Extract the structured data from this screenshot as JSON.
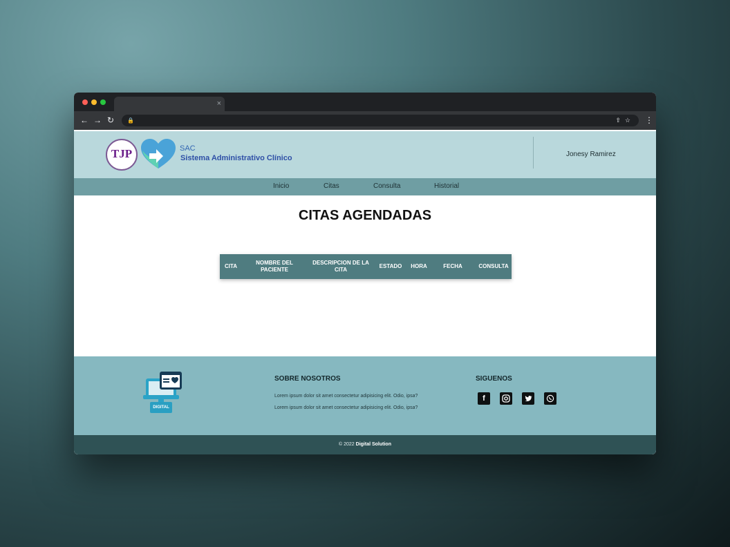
{
  "browser": {
    "traffic_lights": [
      "#ff5f57",
      "#febc2e",
      "#28c840"
    ],
    "tab": {
      "close_glyph": "×"
    },
    "toolbar": {
      "back_icon": "←",
      "forward_icon": "→",
      "reload_icon": "↻",
      "lock_icon": "lock-icon",
      "share_icon": "share-icon",
      "star_icon": "star-icon",
      "menu_icon": "kebab-menu-icon"
    }
  },
  "header": {
    "seal_text": "TJP",
    "brand_short": "SAC",
    "brand_name": "Sistema Administrativo Clínico",
    "user_name": "Jonesy Ramirez"
  },
  "nav": {
    "items": [
      {
        "label": "Inicio"
      },
      {
        "label": "Citas"
      },
      {
        "label": "Consulta"
      },
      {
        "label": "Historial"
      }
    ]
  },
  "main": {
    "title": "CITAS AGENDADAS",
    "table": {
      "columns": [
        "CITA",
        "NOMBRE DEL PACIENTE",
        "DESCRIPCION DE LA CITA",
        "ESTADO",
        "HORA",
        "FECHA",
        "CONSULTA"
      ],
      "rows": []
    }
  },
  "footer": {
    "logo_text": "DIGITAL",
    "about_heading": "SOBRE NOSOTROS",
    "about_lines": [
      "Lorem ipsum dolor sit amet consectetur adipisicing elit. Odio, ipsa?",
      "Lorem ipsum dolor sit amet consectetur adipisicing elit. Odio, ipsa?"
    ],
    "follow_heading": "SIGUENOS",
    "social_icons": [
      "facebook-icon",
      "instagram-icon",
      "twitter-icon",
      "whatsapp-icon"
    ],
    "copyright_prefix": "© 2022",
    "copyright_brand": "Digital Solution"
  },
  "colors": {
    "header_bg": "#b9d8dc",
    "nav_bg": "#6f9ea3",
    "table_header_bg": "#4f7c80",
    "footer_bg": "#86b8c0",
    "copyright_bg": "#2f5255",
    "brand_blue": "#2e4fa6"
  }
}
